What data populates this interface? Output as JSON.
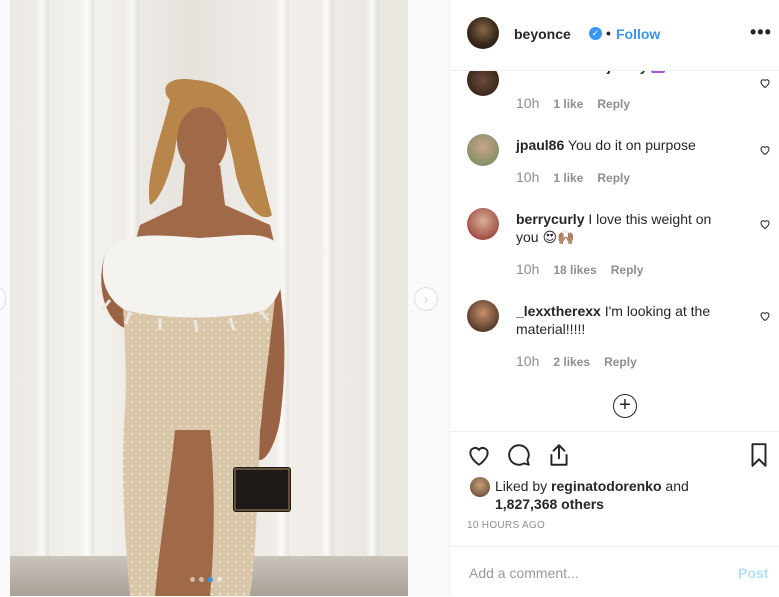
{
  "post": {
    "username": "beyonce",
    "separator": "•",
    "follow_label": "Follow",
    "more_label": "•••"
  },
  "comments": [
    {
      "user": "theduchessofjersey",
      "text": "",
      "time": "10h",
      "likes": "1 like",
      "reply": "Reply"
    },
    {
      "user": "jpaul86",
      "text": "You do it on purpose",
      "time": "10h",
      "likes": "1 like",
      "reply": "Reply"
    },
    {
      "user": "berrycurly",
      "text": "I love this weight on you 😍🙌🏽",
      "time": "10h",
      "likes": "18 likes",
      "reply": "Reply"
    },
    {
      "user": "_lexxtherexx",
      "text": "I'm looking at the material!!!!!",
      "time": "10h",
      "likes": "2 likes",
      "reply": "Reply"
    }
  ],
  "load_more_label": "+",
  "liked_by": {
    "prefix": "Liked by",
    "user": "reginatodorenko",
    "conj": "and",
    "count": "1,827,368 others"
  },
  "timestamp": "10 HOURS AGO",
  "comment_box": {
    "placeholder": "Add a comment...",
    "post_label": "Post"
  },
  "carousel": {
    "total": 4,
    "active_index": 2
  },
  "colors": {
    "accent": "#3897f0",
    "post_disabled": "#b2dffc",
    "meta_gray": "#8e8e8e"
  },
  "icons": {
    "like": "heart-icon",
    "comment": "comment-bubble-icon",
    "share": "share-icon",
    "save": "bookmark-icon",
    "more": "more-options-icon",
    "verified": "verified-badge-icon",
    "next": "chevron-right-icon"
  }
}
